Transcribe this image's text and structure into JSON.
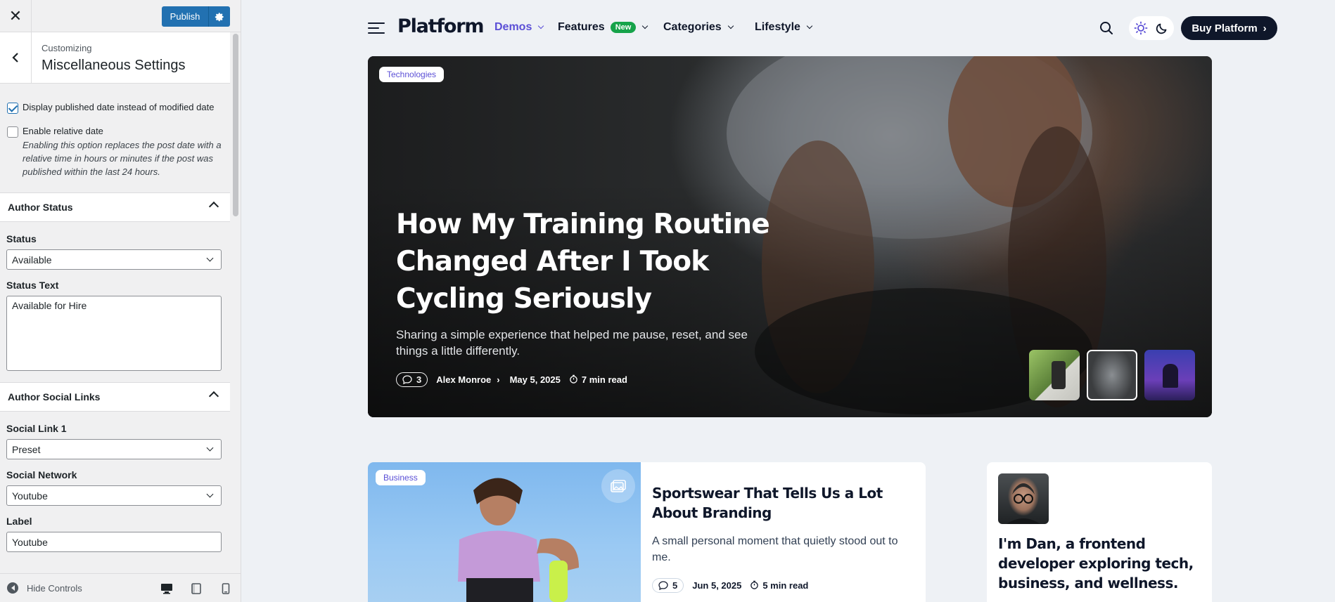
{
  "customizer": {
    "publish_label": "Publish",
    "breadcrumb": "Customizing",
    "panel_title": "Miscellaneous Settings",
    "options": [
      {
        "label": "Display published date instead of modified date",
        "checked": true
      },
      {
        "label": "Enable relative date",
        "checked": false,
        "description": "Enabling this option replaces the post date with a relative time in hours or minutes if the post was published within the last 24 hours."
      }
    ],
    "author_status": {
      "section_title": "Author Status",
      "status_label": "Status",
      "status_value": "Available",
      "status_text_label": "Status Text",
      "status_text_value": "Available for Hire"
    },
    "author_social": {
      "section_title": "Author Social Links",
      "social_link_label": "Social Link 1",
      "social_link_value": "Preset",
      "network_label": "Social Network",
      "network_value": "Youtube",
      "label_label": "Label",
      "label_value": "Youtube"
    },
    "footer": {
      "hide_controls": "Hide Controls"
    }
  },
  "site": {
    "logo": "Platform",
    "nav": [
      {
        "label": "Demos",
        "active": true
      },
      {
        "label": "Features",
        "badge": "New"
      },
      {
        "label": "Categories"
      },
      {
        "label": "Lifestyle"
      }
    ],
    "buy_label": "Buy Platform",
    "accent_color": "#5b4fd6",
    "hero": {
      "tag": "Technologies",
      "title": "How My Training Routine Changed After I Took Cycling Seriously",
      "excerpt": "Sharing a simple experience that helped me pause, reset, and see things a little differently.",
      "comments": "3",
      "author": "Alex Monroe",
      "date": "May 5, 2025",
      "read_time": "7 min read"
    },
    "card": {
      "tag": "Business",
      "title": "Sportswear That Tells Us a Lot About Branding",
      "excerpt": "A small personal moment that quietly stood out to me.",
      "comments": "5",
      "date": "Jun 5, 2025",
      "read_time": "5 min read"
    },
    "about": {
      "text": "I'm Dan, a frontend developer exploring tech, business, and wellness."
    }
  }
}
